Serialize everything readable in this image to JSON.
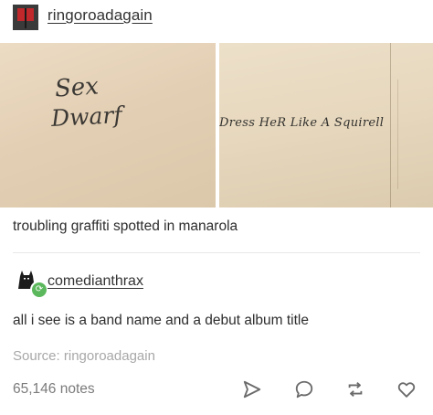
{
  "post": {
    "author": "ringoroadagain",
    "images": [
      {
        "graffiti_lines": [
          "Sex",
          "Dwarf"
        ]
      },
      {
        "graffiti_lines": [
          "Dress HeR Like A Squirell"
        ]
      }
    ],
    "caption": "troubling graffiti spotted in manarola"
  },
  "reblog": {
    "author": "comedianthrax",
    "text": "all i see is a band name and a debut album title"
  },
  "source": {
    "text": "Source: ringoroadagain"
  },
  "footer": {
    "notes": "65,146 notes",
    "actions": [
      "share-icon",
      "reply-icon",
      "reblog-icon",
      "heart-icon"
    ]
  },
  "colors": {
    "text": "#2d2d2d",
    "muted": "#a8a8a8",
    "notes": "#7b7b7b",
    "icon": "#6b6b6b",
    "badge_green": "#5cb85c"
  }
}
